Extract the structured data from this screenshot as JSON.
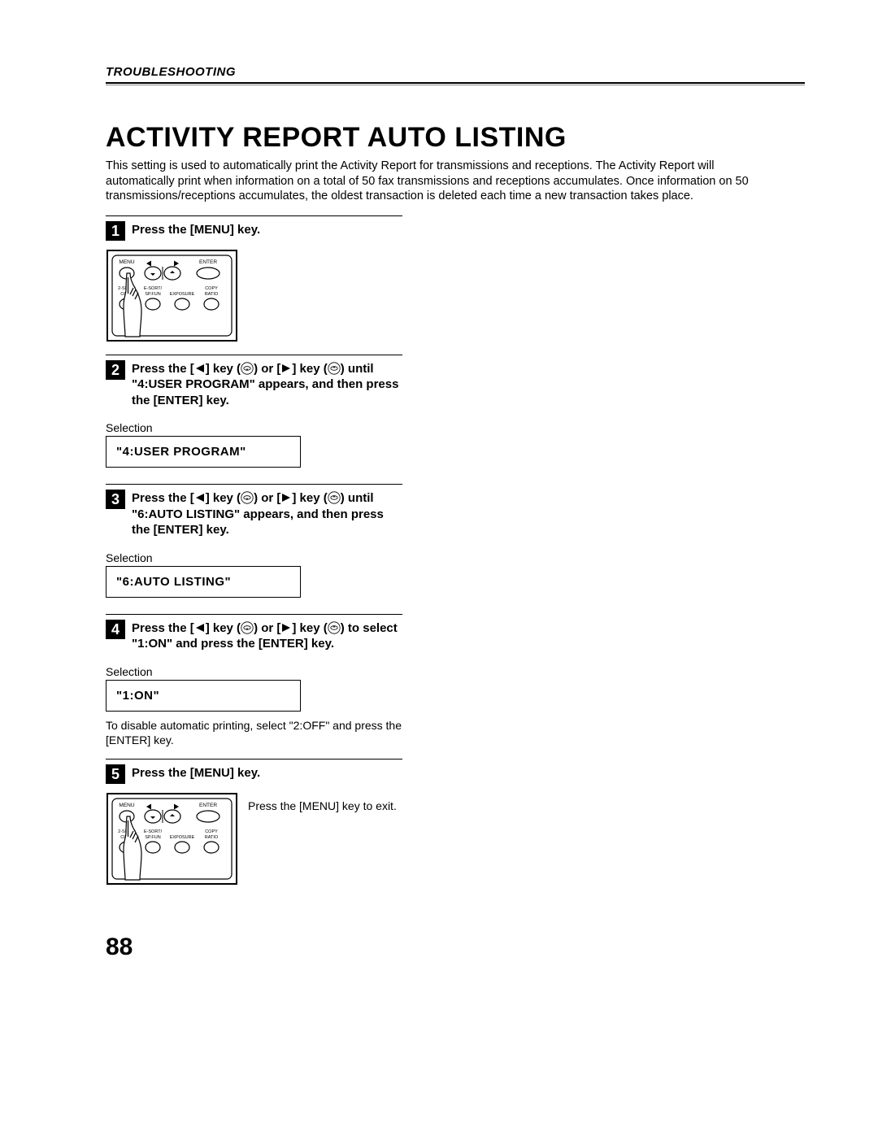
{
  "section_header": "TROUBLESHOOTING",
  "title": "ACTIVITY REPORT AUTO LISTING",
  "intro": "This setting is used to automatically print the Activity Report for transmissions and receptions. The Activity Report will automatically print when information on a total of 50 fax transmissions and receptions accumulates. Once information on 50 transmissions/receptions accumulates, the oldest transaction is deleted each time a new transaction takes place.",
  "steps": {
    "s1": {
      "num": "1",
      "title": "Press the [MENU] key."
    },
    "s2": {
      "num": "2",
      "title_before": "Press the [",
      "title_mid1": "] key (",
      "title_mid2": ") or [",
      "title_mid3": "] key (",
      "title_after": ") until \"4:USER PROGRAM\" appears, and then press the [ENTER] key.",
      "sel_label": "Selection",
      "display": "\"4:USER PROGRAM\""
    },
    "s3": {
      "num": "3",
      "title_before": "Press the [",
      "title_mid1": "] key (",
      "title_mid2": ") or [",
      "title_mid3": "] key (",
      "title_after": ") until \"6:AUTO LISTING\" appears, and then press the [ENTER] key.",
      "sel_label": "Selection",
      "display": "\"6:AUTO LISTING\""
    },
    "s4": {
      "num": "4",
      "title_before": "Press the [",
      "title_mid1": "] key (",
      "title_mid2": ") or [",
      "title_mid3": "] key (",
      "title_after": ") to select \"1:ON\" and press the [ENTER] key.",
      "sel_label": "Selection",
      "display": "\"1:ON\"",
      "note": "To disable automatic printing, select \"2:OFF\" and press the [ENTER] key."
    },
    "s5": {
      "num": "5",
      "title": "Press the [MENU] key.",
      "side": "Press the [MENU] key to exit."
    }
  },
  "panel_labels": {
    "menu": "MENU",
    "enter": "ENTER",
    "row2a": "2-SIDED",
    "row2a_sub": "COPY",
    "row2b": "E-SORT/",
    "row2b_sub": "SP.FUN",
    "row2c": "EXPOSURE",
    "row2d": "COPY",
    "row2d_sub": "RATIO"
  },
  "page_number": "88"
}
